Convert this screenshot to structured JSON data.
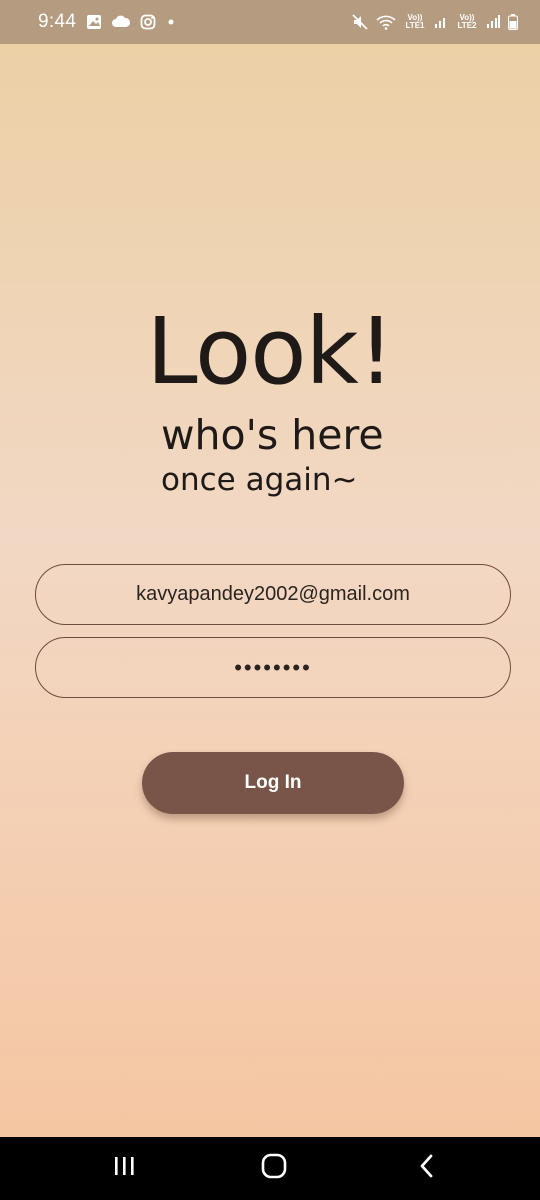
{
  "status_bar": {
    "time": "9:44",
    "network1": "Vo)) LTE1",
    "network2": "Vo)) LTE2"
  },
  "login": {
    "headline": "Look!",
    "subtitle_line1": "who's here",
    "subtitle_line2": "once again~",
    "email_value": "kavyapandey2002@gmail.com",
    "password_value": "••••••••",
    "login_button_label": "Log In"
  },
  "colors": {
    "status_bar_bg": "#b59c80",
    "gradient_top": "#ecd0a6",
    "gradient_bottom": "#f5c6a2",
    "button_bg": "#785548",
    "field_border": "#6e4b3e",
    "text": "#1f1a17"
  },
  "icons": [
    "gallery-icon",
    "cloud-icon",
    "instagram-icon",
    "notification-dot-icon",
    "mute-icon",
    "wifi-icon",
    "signal-icon",
    "battery-icon",
    "recent-apps-icon",
    "home-icon",
    "back-icon"
  ]
}
